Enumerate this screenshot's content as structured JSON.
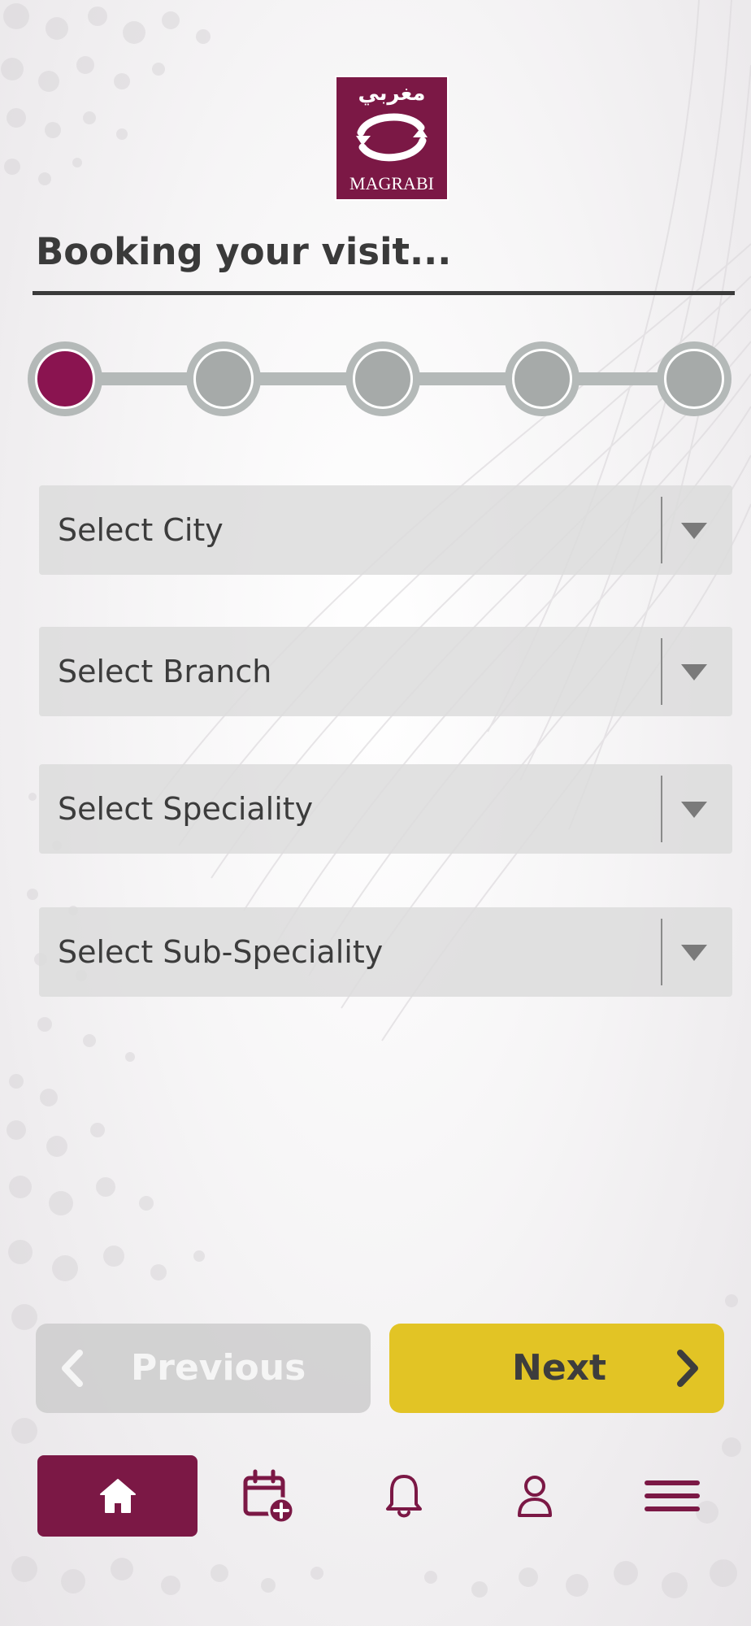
{
  "brand": {
    "arabic_name": "مغربي",
    "name": "MAGRABI",
    "color": "#7b1845"
  },
  "header": {
    "title": "Booking your visit..."
  },
  "stepper": {
    "total_steps": 5,
    "current_step": 1,
    "active_color": "#8a1450",
    "inactive_color": "#a6aaa9"
  },
  "form": {
    "city": {
      "placeholder": "Select City"
    },
    "branch": {
      "placeholder": "Select Branch"
    },
    "speciality": {
      "placeholder": "Select Speciality"
    },
    "sub_speciality": {
      "placeholder": "Select Sub-Speciality"
    }
  },
  "actions": {
    "previous_label": "Previous",
    "next_label": "Next",
    "next_color": "#e2c425"
  },
  "bottom_nav": {
    "items": [
      {
        "icon": "home-icon",
        "active": true
      },
      {
        "icon": "calendar-add-icon",
        "active": false
      },
      {
        "icon": "bell-icon",
        "active": false
      },
      {
        "icon": "user-icon",
        "active": false
      },
      {
        "icon": "menu-icon",
        "active": false
      }
    ]
  }
}
